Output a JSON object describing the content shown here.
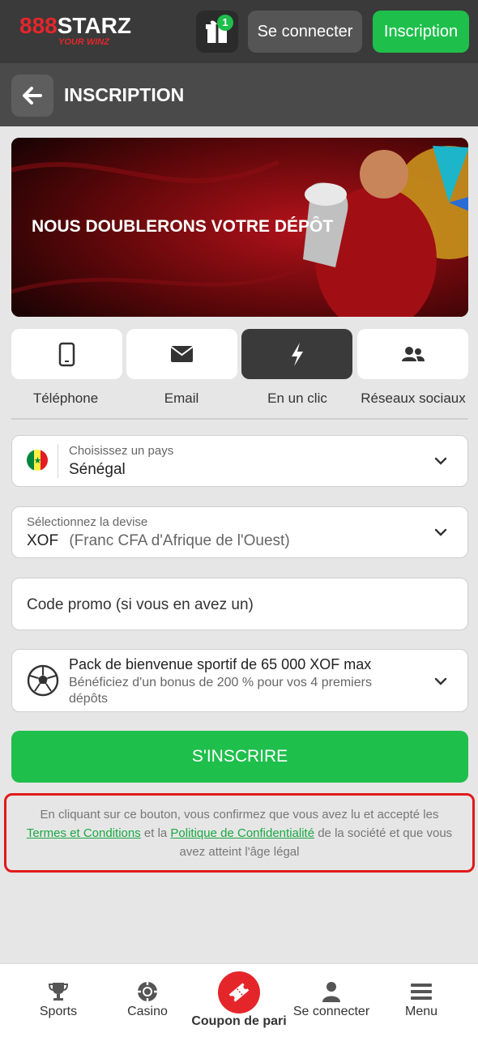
{
  "header": {
    "logo_number": "888",
    "logo_word": "STARZ",
    "logo_tagline": "YOUR WINZ",
    "gift_count": "1",
    "login_label": "Se connecter",
    "signup_label": "Inscription"
  },
  "titlebar": {
    "title": "INSCRIPTION",
    "back_icon": "arrow-left-icon"
  },
  "banner": {
    "text": "NOUS DOUBLERONS VOTRE DÉPÔT"
  },
  "methods": [
    {
      "label": "Téléphone",
      "icon": "phone-icon",
      "active": false
    },
    {
      "label": "Email",
      "icon": "envelope-icon",
      "active": false
    },
    {
      "label": "En un clic",
      "icon": "lightning-icon",
      "active": true
    },
    {
      "label": "Réseaux sociaux",
      "icon": "people-icon",
      "active": false
    }
  ],
  "form": {
    "country": {
      "label": "Choisissez un pays",
      "value": "Sénégal",
      "flag_colors": [
        "#00853f",
        "#fdef42",
        "#e31b23"
      ]
    },
    "currency": {
      "label": "Sélectionnez la devise",
      "code": "XOF",
      "name": "(Franc CFA d'Afrique de l'Ouest)"
    },
    "promo": {
      "placeholder": "Code promo (si vous en avez un)"
    },
    "bonus": {
      "title": "Pack de bienvenue sportif de 65 000 XOF max",
      "desc_line1": "Bénéficiez d'un bonus de 200 % pour vos 4 premiers",
      "desc_line2": "dépôts"
    },
    "submit_label": "S'INSCRIRE"
  },
  "legal": {
    "part1": "En cliquant sur ce bouton, vous confirmez que vous avez lu et accepté les",
    "terms_link": "Termes et Conditions",
    "part2": "et la",
    "privacy_link": "Politique de Confidentialité",
    "part3": "de la société et que vous avez atteint l'âge légal"
  },
  "bottom_nav": [
    {
      "label": "Sports",
      "icon": "trophy-icon"
    },
    {
      "label": "Casino",
      "icon": "chip-icon"
    },
    {
      "label": "Coupon de pari",
      "icon": "ticket-icon"
    },
    {
      "label": "Se connecter",
      "icon": "user-icon"
    },
    {
      "label": "Menu",
      "icon": "hamburger-icon"
    }
  ],
  "colors": {
    "brand_green": "#1fbf4c",
    "brand_red": "#e4262b",
    "header_bg": "#3a3a3a"
  }
}
